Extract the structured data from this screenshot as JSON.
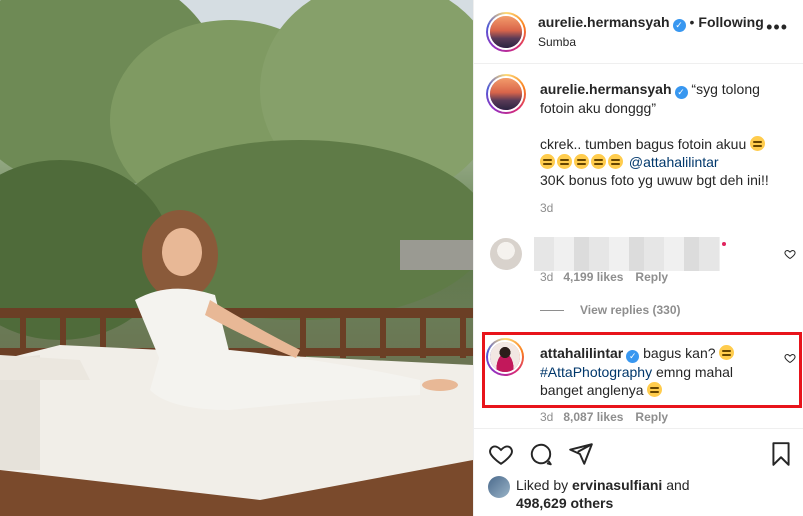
{
  "post": {
    "author": "aurelie.hermansyah",
    "follow_status": "Following",
    "location": "Sumba",
    "more_icon": "ellipsis-icon"
  },
  "caption": {
    "author": "aurelie.hermansyah",
    "line1": "“syg tolong",
    "line2": "fotoin aku donggg”",
    "line3": "ckrek.. tumben bagus fotoin akuu",
    "mention": "@attahalilintar",
    "line5": "30K bonus foto yg uwuw bgt deh ini!!",
    "time": "3d"
  },
  "comment1": {
    "time": "3d",
    "likes": "4,199 likes",
    "reply": "Reply",
    "view_replies": "View replies (330)"
  },
  "comment2": {
    "author": "attahalilintar",
    "text_start": "bagus kan?",
    "hashtag": "#AttaPhotography",
    "text_mid": "emng mahal",
    "text_end": "banget anglenya",
    "time": "3d",
    "likes": "8,087 likes",
    "reply": "Reply"
  },
  "likes_summary": {
    "liked_by_prefix": "Liked by",
    "liker": "ervinasulfiani",
    "and": "and",
    "others": "498,629 others"
  },
  "colors": {
    "highlight_border": "#e8141b",
    "verified_blue": "#3897f0",
    "mention_blue": "#00376b"
  }
}
